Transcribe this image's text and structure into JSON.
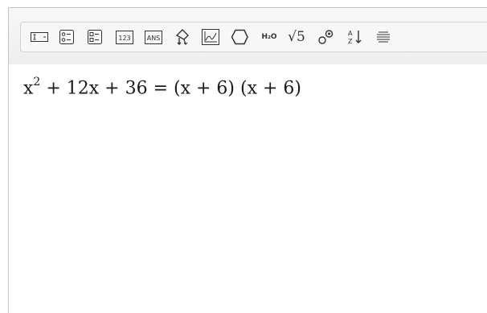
{
  "toolbar": {
    "buttons": [
      {
        "name": "textbox-tool",
        "icon": "textbox-icon"
      },
      {
        "name": "multiple-choice-tool",
        "icon": "multiple-choice-icon"
      },
      {
        "name": "checklist-tool",
        "icon": "checklist-icon"
      },
      {
        "name": "numeric-tool",
        "icon": "numeric-icon",
        "text": "123"
      },
      {
        "name": "answer-tool",
        "icon": "answer-icon",
        "text": "ANS"
      },
      {
        "name": "drag-point-tool",
        "icon": "drag-point-icon"
      },
      {
        "name": "graph-tool",
        "icon": "graph-icon"
      },
      {
        "name": "shape-tool",
        "icon": "shape-icon"
      },
      {
        "name": "chemistry-tool",
        "icon": "chemistry-icon",
        "text": "H₂O"
      },
      {
        "name": "sqrt-tool",
        "icon": "sqrt-icon",
        "text": "√5"
      },
      {
        "name": "chem-structure-tool",
        "icon": "molecule-icon"
      },
      {
        "name": "sort-tool",
        "icon": "sort-az-icon"
      },
      {
        "name": "more-tool",
        "icon": "list-lines-icon"
      }
    ]
  },
  "editor": {
    "equation_lhs": "x",
    "equation_exp": "2",
    "equation_rest": " + 12x + 36 = (x + 6) (x + 6)"
  }
}
